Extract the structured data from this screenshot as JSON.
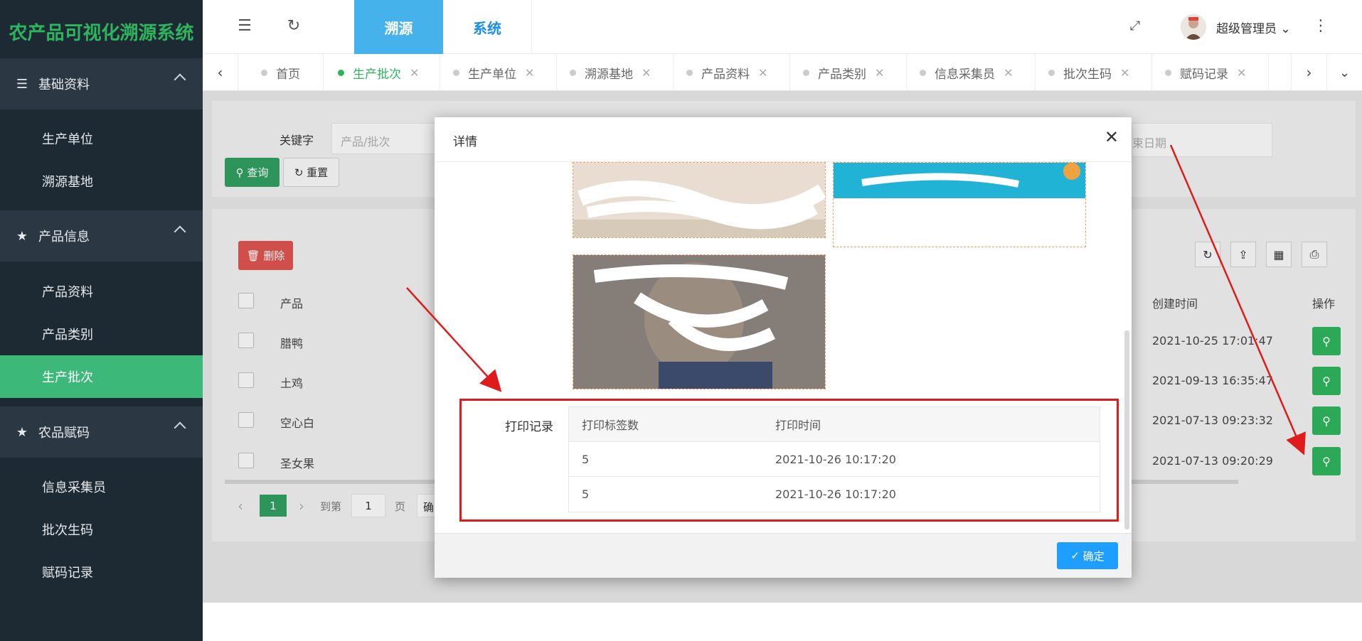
{
  "app": {
    "title": "农产品可视化溯源系统"
  },
  "sidebar": {
    "groups": [
      {
        "label": "基础资料",
        "icon": "list-icon",
        "items": [
          "生产单位",
          "溯源基地"
        ]
      },
      {
        "label": "产品信息",
        "icon": "star-icon",
        "items": [
          "产品资料",
          "产品类别",
          "生产批次"
        ]
      },
      {
        "label": "农品赋码",
        "icon": "star-icon",
        "items": [
          "信息采集员",
          "批次生码",
          "赋码记录"
        ]
      }
    ],
    "active_item": "生产批次"
  },
  "header": {
    "top_tabs": [
      "溯源",
      "系统"
    ],
    "active_top_tab": "溯源",
    "user": "超级管理员"
  },
  "tabs": [
    {
      "label": "首页",
      "closable": false
    },
    {
      "label": "生产批次",
      "closable": true,
      "active": true
    },
    {
      "label": "生产单位",
      "closable": true
    },
    {
      "label": "溯源基地",
      "closable": true
    },
    {
      "label": "产品资料",
      "closable": true
    },
    {
      "label": "产品类别",
      "closable": true
    },
    {
      "label": "信息采集员",
      "closable": true
    },
    {
      "label": "批次生码",
      "closable": true
    },
    {
      "label": "赋码记录",
      "closable": true
    }
  ],
  "search": {
    "keyword_label": "关键字",
    "keyword_placeholder": "产品/批次",
    "date_placeholder": "束日期",
    "query_button": "查询",
    "reset_button": "重置"
  },
  "table": {
    "delete_button": "删除",
    "columns": {
      "product": "产品",
      "created": "创建时间",
      "actions": "操作"
    },
    "rows": [
      {
        "product": "腊鸭",
        "created": "2021-10-25 17:01:47"
      },
      {
        "product": "土鸡",
        "created": "2021-09-13 16:35:47"
      },
      {
        "product": "空心白",
        "created": "2021-07-13 09:23:32"
      },
      {
        "product": "圣女果",
        "created": "2021-07-13 09:20:29"
      }
    ]
  },
  "pagination": {
    "current": "1",
    "goto_label": "到第",
    "goto_value": "1",
    "page_label": "页",
    "confirm": "确"
  },
  "modal": {
    "title": "详情",
    "print_label": "打印记录",
    "print_columns": [
      "打印标签数",
      "打印时间"
    ],
    "print_rows": [
      {
        "count": "5",
        "time": "2021-10-26 10:17:20"
      },
      {
        "count": "5",
        "time": "2021-10-26 10:17:20"
      }
    ],
    "ok_button": "确定"
  },
  "colors": {
    "sidebar_bg": "#1d2a34",
    "accent_green": "#3cb878",
    "top_tab_blue": "#45b2ec",
    "ok_blue": "#1e9fff",
    "annotation_red": "#e01b1b"
  }
}
